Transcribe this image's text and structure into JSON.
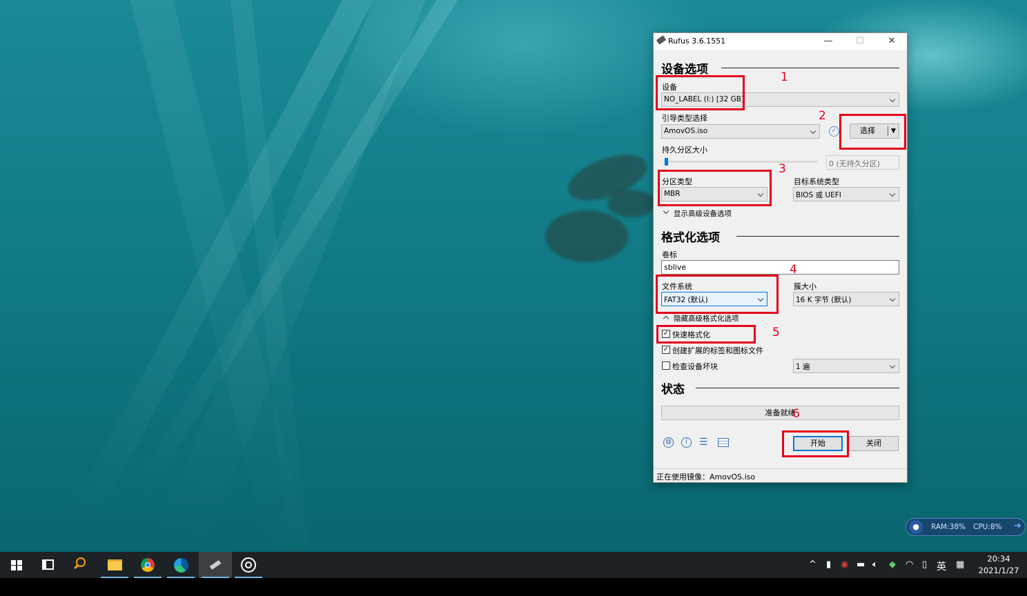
{
  "window": {
    "title": "Rufus 3.6.1551",
    "minimize": "—",
    "maximize": "☐",
    "close": "✕"
  },
  "device_section": {
    "heading": "设备选项",
    "device_label": "设备",
    "device_value": "NO_LABEL (I:) [32 GB]",
    "boot_label": "引导类型选择",
    "boot_value": "AmovOS.iso",
    "select_button": "选择",
    "persistent_label": "持久分区大小",
    "persistent_value": "0 (无持久分区)",
    "partition_label": "分区类型",
    "partition_value": "MBR",
    "target_label": "目标系统类型",
    "target_value": "BIOS 或 UEFI",
    "advanced_toggle": "显示高级设备选项"
  },
  "format_section": {
    "heading": "格式化选项",
    "volume_label": "卷标",
    "volume_value": "sblive",
    "fs_label": "文件系统",
    "fs_value": "FAT32 (默认)",
    "cluster_label": "簇大小",
    "cluster_value": "16 K 字节 (默认)",
    "advanced_toggle": "隐藏高级格式化选项",
    "quick_format": "快速格式化",
    "quick_format_checked": true,
    "extended_label": "创建扩展的标签和图标文件",
    "extended_checked": true,
    "bad_blocks": "检查设备坏块",
    "bad_blocks_checked": false,
    "passes_value": "1 遍"
  },
  "status_section": {
    "heading": "状态",
    "status_text": "准备就绪"
  },
  "actions": {
    "start": "开始",
    "close": "关闭"
  },
  "statusbar": {
    "text": "正在使用镜像：AmovOS.iso"
  },
  "annotations": [
    "1",
    "2",
    "3",
    "4",
    "5",
    "6"
  ],
  "monitor_widget": {
    "ram": "RAM:38%",
    "cpu": "CPU:8%"
  },
  "taskbar": {
    "ime": "英",
    "time": "20:34",
    "date": "2021/1/27"
  },
  "colors": {
    "annotation_red": "#e3001b",
    "accent_blue": "#0078d7"
  }
}
